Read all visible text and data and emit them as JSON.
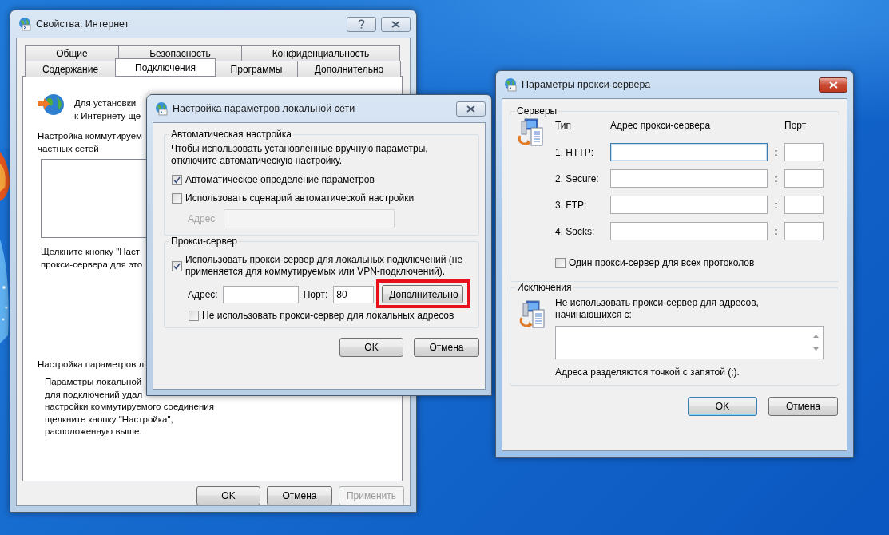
{
  "internet_properties": {
    "title": "Свойства: Интернет",
    "active": false,
    "tab_rows": [
      {
        "tabs": [
          {
            "label": "Общие",
            "selected": false
          },
          {
            "label": "Безопасность",
            "selected": false
          },
          {
            "label": "Конфиденциальность",
            "selected": false
          }
        ]
      },
      {
        "tabs": [
          {
            "label": "Содержание",
            "selected": false
          },
          {
            "label": "Подключения",
            "selected": true
          },
          {
            "label": "Программы",
            "selected": false
          },
          {
            "label": "Дополнительно",
            "selected": false
          }
        ]
      }
    ],
    "intro_lines": [
      "Для установки",
      "к Интернету ще"
    ],
    "dialup_lines": [
      "Настройка коммутируем",
      "частных сетей"
    ],
    "proxy_hint_lines": [
      "Щелкните кнопку \"Наст",
      "прокси-сервера для это"
    ],
    "lan_group": {
      "title": "Настройка параметров л",
      "lines": [
        "Параметры локальной",
        "для подключений удал",
        "настройки коммутируемого соединения",
        "щелкните кнопку \"Настройка\",",
        "расположенную выше."
      ]
    },
    "buttons": [
      {
        "label": "OK",
        "disabled": false
      },
      {
        "label": "Отмена",
        "disabled": false
      },
      {
        "label": "Применить",
        "disabled": true
      }
    ]
  },
  "lan_settings": {
    "title": "Настройка параметров локальной сети",
    "active": false,
    "auto_group": {
      "title": "Автоматическая настройка",
      "note_lines": [
        "Чтобы использовать установленные вручную параметры,",
        "отключите автоматическую настройку."
      ],
      "options": [
        {
          "label": "Автоматическое определение параметров",
          "checked": true
        },
        {
          "label": "Использовать сценарий автоматической настройки",
          "checked": false
        }
      ],
      "script_address": {
        "label": "Адрес",
        "disabled": true
      }
    },
    "proxy_group": {
      "title": "Прокси-сервер",
      "use_proxy": {
        "lines": [
          "Использовать прокси-сервер для локальных подключений (не",
          "применяется для коммутируемых или VPN-подключений)."
        ],
        "checked": true
      },
      "address": {
        "label": "Адрес:"
      },
      "port": {
        "label": "Порт:",
        "value": "80"
      },
      "advanced_button": {
        "label": "Дополнительно",
        "highlighted": true
      },
      "bypass_local": {
        "label": "Не использовать прокси-сервер для локальных адресов",
        "checked": false
      }
    },
    "buttons": [
      {
        "label": "OK",
        "default": false
      },
      {
        "label": "Отмена",
        "default": false
      }
    ]
  },
  "proxy_settings": {
    "title": "Параметры прокси-сервера",
    "active": true,
    "servers_group": {
      "title": "Серверы",
      "columns": [
        "Тип",
        "Адрес прокси-сервера",
        "Порт"
      ],
      "rows": [
        {
          "type": "1. HTTP:",
          "separator": ":",
          "focused": true
        },
        {
          "type": "2. Secure:",
          "separator": ":",
          "focused": false
        },
        {
          "type": "3. FTP:",
          "separator": ":",
          "focused": false
        },
        {
          "type": "4. Socks:",
          "separator": ":",
          "focused": false
        }
      ],
      "same_proxy": {
        "label": "Один прокси-сервер для всех протоколов",
        "checked": false
      }
    },
    "exceptions_group": {
      "title": "Исключения",
      "lines": [
        "Не использовать прокси-сервер для адресов,",
        "начинающихся с:"
      ],
      "note": "Адреса разделяются точкой с запятой (;)."
    },
    "buttons": [
      {
        "label": "OK",
        "default": true
      },
      {
        "label": "Отмена",
        "default": false
      }
    ]
  }
}
